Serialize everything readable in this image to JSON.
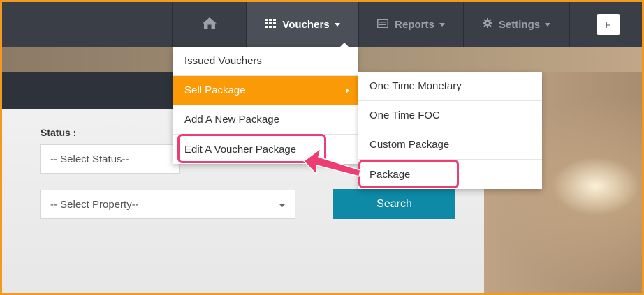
{
  "nav": {
    "home_icon": "home-icon",
    "vouchers": {
      "label": "Vouchers",
      "icon": "grid-icon"
    },
    "reports": {
      "label": "Reports",
      "icon": "list-icon"
    },
    "settings": {
      "label": "Settings",
      "icon": "gear-icon"
    },
    "user_initial": "F"
  },
  "vouchers_menu": {
    "items": [
      {
        "label": "Issued Vouchers"
      },
      {
        "label": "Sell Package"
      },
      {
        "label": "Add A New Package"
      },
      {
        "label": "Edit A Voucher Package"
      }
    ]
  },
  "sell_package_submenu": {
    "items": [
      {
        "label": "One Time Monetary"
      },
      {
        "label": "One Time FOC"
      },
      {
        "label": "Custom Package"
      },
      {
        "label": "Package"
      }
    ]
  },
  "filters": {
    "status_label": "Status :",
    "status_placeholder": "-- Select Status--",
    "property_placeholder": "-- Select Property--",
    "search_label": "Search"
  },
  "colors": {
    "accent_orange": "#fb9a07",
    "highlight_pink": "#ee3d73",
    "search_teal": "#0e8aa7",
    "navbar": "#3a3e46"
  }
}
